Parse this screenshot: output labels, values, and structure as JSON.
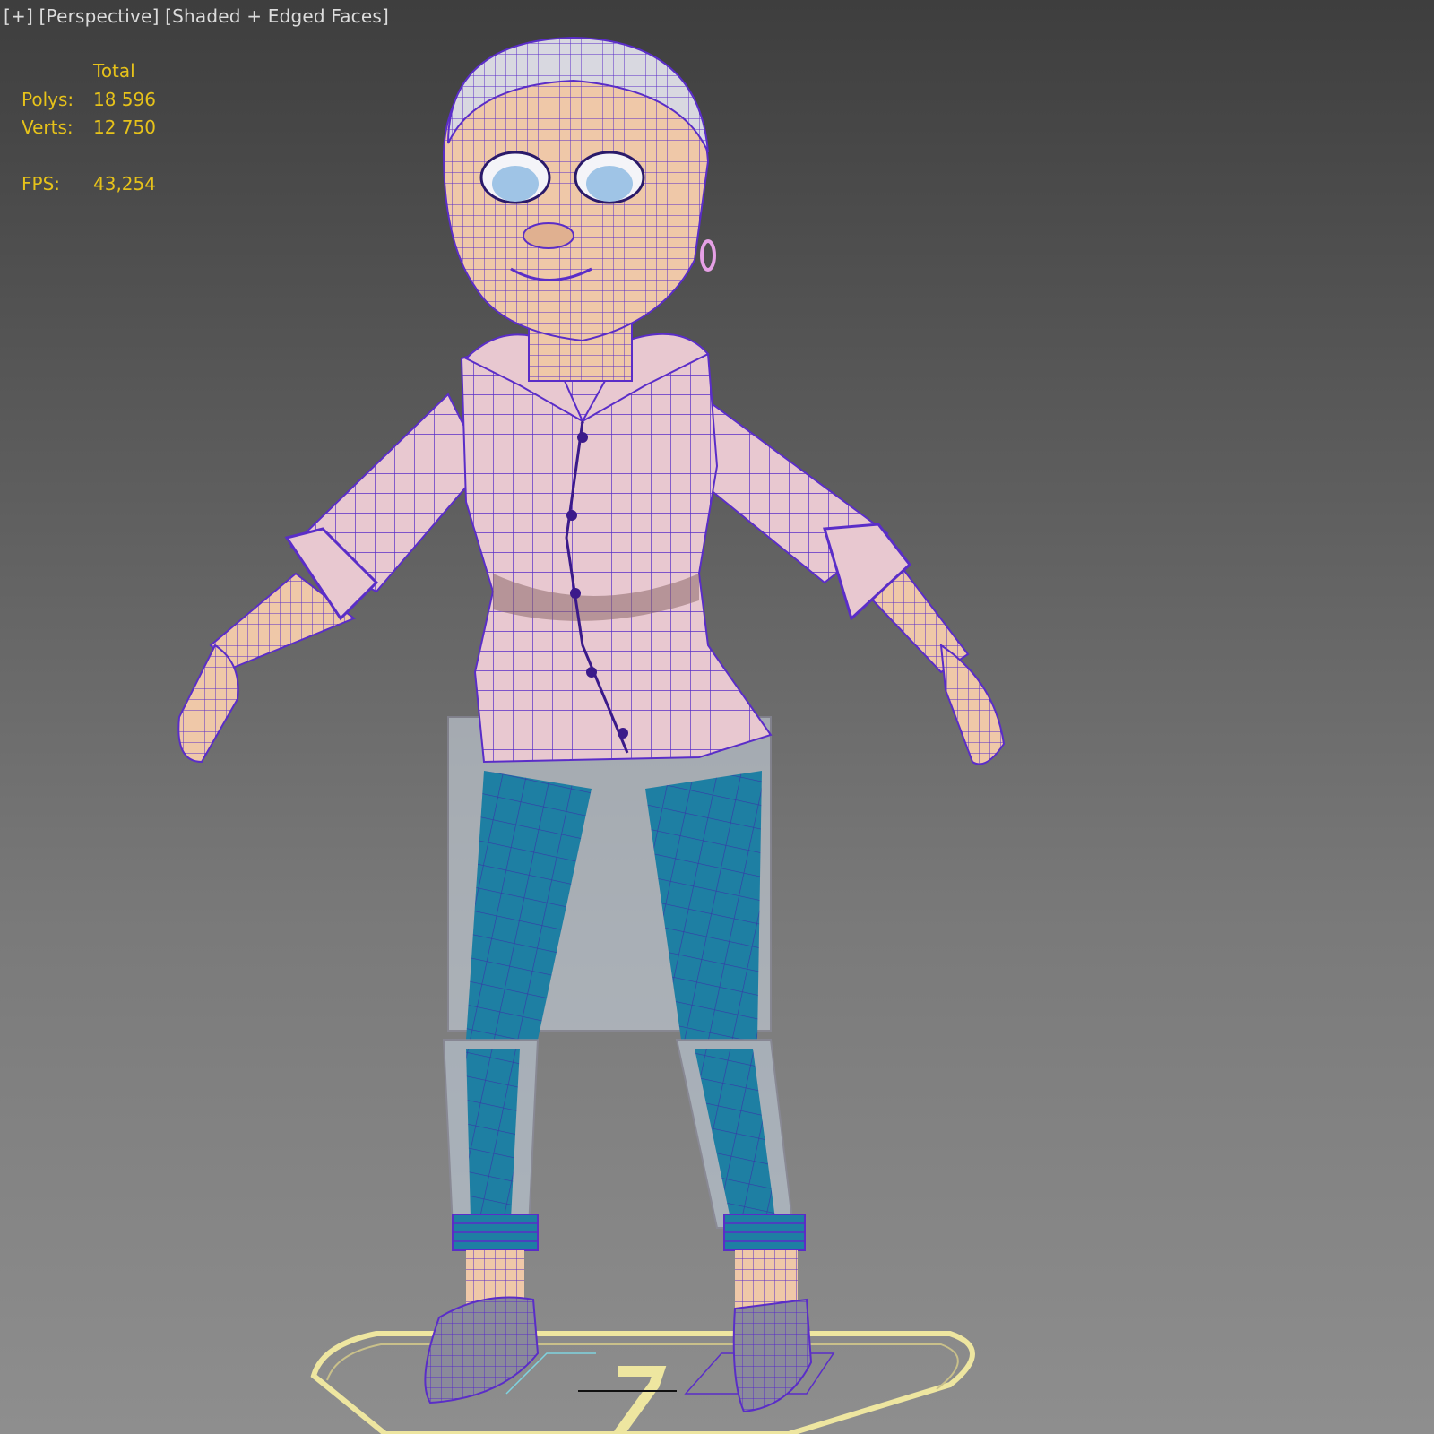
{
  "viewport": {
    "menu_label": "[+]",
    "view_label": "[Perspective]",
    "shading_label": "[Shaded + Edged Faces]"
  },
  "stats": {
    "header": "Total",
    "polys_label": "Polys:",
    "polys_value": "18 596",
    "verts_label": "Verts:",
    "verts_value": "12 750",
    "fps_label": "FPS:",
    "fps_value": "43,254"
  },
  "colors": {
    "stats_text": "#e6c21a",
    "label_text": "#dcdcdc",
    "wireframe": "#5a2dc8",
    "skin": "#efc8a8",
    "shirt": "#e8c8d0",
    "jeans": "#1e7fa3",
    "gizmo": "#eee6a0"
  }
}
